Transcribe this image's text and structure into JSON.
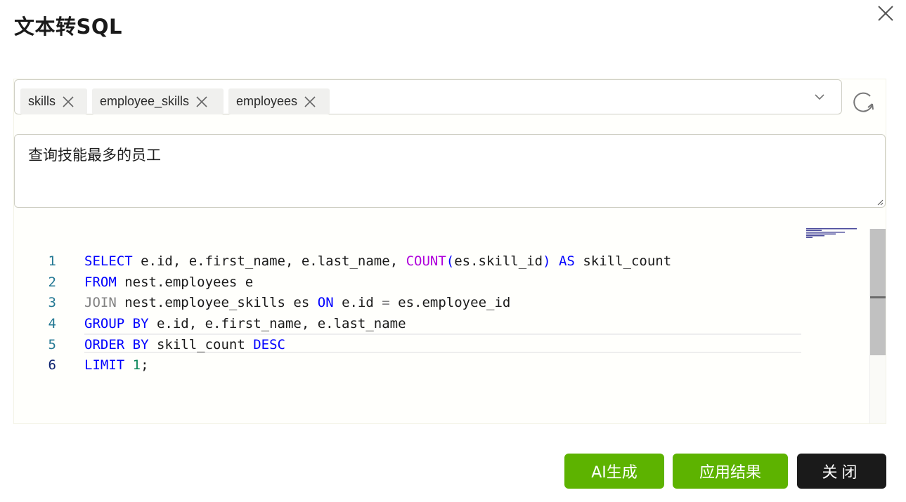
{
  "dialog": {
    "title": "文本转SQL"
  },
  "tables": {
    "tags": [
      {
        "label": "skills"
      },
      {
        "label": "employee_skills"
      },
      {
        "label": "employees"
      }
    ]
  },
  "question": {
    "value": "查询技能最多的员工"
  },
  "editor": {
    "line_numbers": [
      "1",
      "2",
      "3",
      "4",
      "5",
      "6"
    ],
    "lines": [
      "SELECT e.id, e.first_name, e.last_name, COUNT(es.skill_id) AS skill_count",
      "FROM nest.employees e",
      "JOIN nest.employee_skills es ON e.id = es.employee_id",
      "GROUP BY e.id, e.first_name, e.last_name",
      "ORDER BY skill_count DESC",
      "LIMIT 1;"
    ],
    "current_line": 6,
    "colors": {
      "keyword": "#0000ff",
      "function": "#af00db",
      "number": "#098658",
      "line_number": "#237893"
    }
  },
  "buttons": {
    "ai_generate": "AI生成",
    "apply_result": "应用结果",
    "close": "关闭"
  },
  "icons": {
    "close": "close-icon",
    "tag_remove": "x-icon",
    "dropdown": "chevron-down-icon",
    "refresh": "refresh-icon"
  },
  "colors": {
    "accent_green": "#5db300",
    "close_button": "#1a1a1a"
  }
}
